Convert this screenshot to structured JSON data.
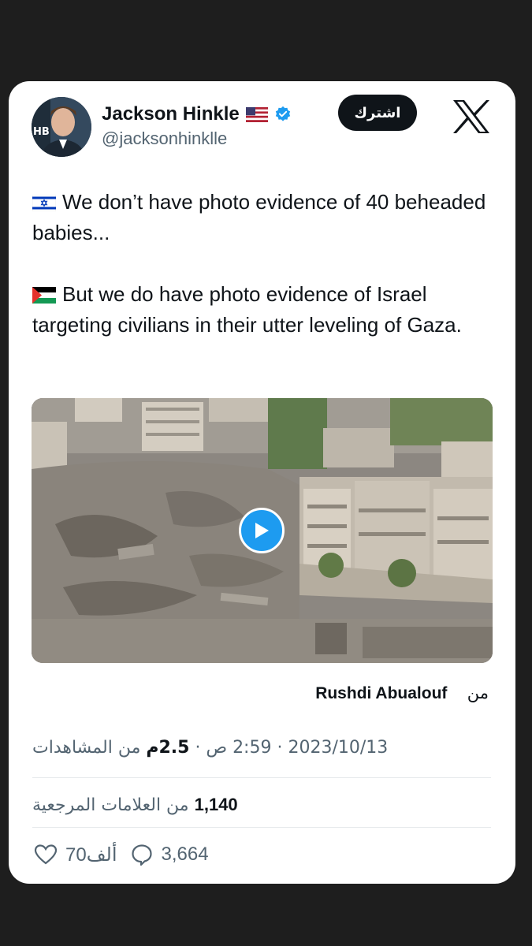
{
  "author": {
    "name": "Jackson Hinkle",
    "handle": "@jacksonhinklle",
    "flag_icon": "us-flag-icon",
    "verified_icon": "verified-badge-icon"
  },
  "header": {
    "subscribe_label": "اشترك",
    "logo_icon": "x-logo-icon"
  },
  "tweet": {
    "paragraph1": {
      "flag_icon": "israel-flag-icon",
      "text": "We don’t have photo evidence of 40 beheaded babies..."
    },
    "paragraph2": {
      "flag_icon": "palestine-flag-icon",
      "text": "But we do have photo evidence of Israel targeting civilians in their utter leveling of Gaza."
    }
  },
  "media": {
    "play_icon": "play-icon"
  },
  "source": {
    "prefix": "من",
    "name": "Rushdi Abualouf"
  },
  "meta": {
    "date": "2023/10/13",
    "time": "2:59 ص",
    "views_count": "2.5م",
    "views_label": "من المشاهدات",
    "separator": " · "
  },
  "bookmarks": {
    "count": "1,140",
    "label": "من العلامات المرجعية"
  },
  "actions": {
    "replies": "3,664",
    "likes": "70ألف",
    "reply_icon": "reply-icon",
    "like_icon": "heart-icon"
  },
  "colors": {
    "background": "#1e1e1e",
    "card": "#ffffff",
    "text": "#0f1419",
    "secondary": "#536471",
    "accent": "#1d9bf0"
  }
}
